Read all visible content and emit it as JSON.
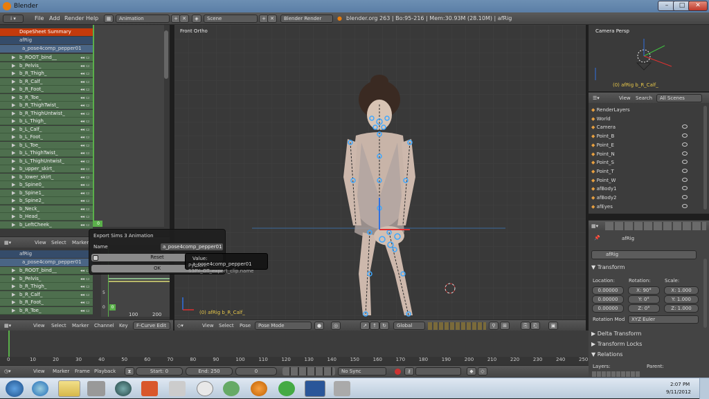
{
  "window": {
    "title": "Blender"
  },
  "menubar": {
    "menus": [
      "File",
      "Add",
      "Render",
      "Help"
    ],
    "screen_layout": "Animation",
    "scene": "Scene",
    "render_engine": "Blender Render",
    "stats": "blender.org 263 | Bo:95-216 | Mem:30.93M (28.10M) | afRig"
  },
  "dopesheet": {
    "summary": "DopeSheet Summary",
    "rig": "afRig",
    "action": "a_pose4comp_pepper01",
    "channels": [
      "b_ROOT_bind__",
      "b_Pelvis_",
      "b_R_Thigh_",
      "b_R_Calf_",
      "b_R_Foot_",
      "b_R_Toe_",
      "b_R_ThighTwist_",
      "b_R_ThighUntwist_",
      "b_L_Thigh_",
      "b_L_Calf_",
      "b_L_Foot_",
      "b_L_Toe_",
      "b_L_ThighTwist_",
      "b_L_ThighUntwist_",
      "b_upper_skirt_",
      "b_lower_skirt_",
      "b_Spine0_",
      "b_Spine1_",
      "b_Spine2_",
      "b_Neck_",
      "b_Head_",
      "b_LeftCheek_"
    ],
    "frame_marker": "0",
    "header": [
      "View",
      "Select",
      "Marker"
    ]
  },
  "export_dialog": {
    "title": "Export Sims 3 Animation",
    "name_label": "Name",
    "name_value": "a_pose4comp_pepper01",
    "reset_label": "Reset",
    "ok_label": "OK",
    "tooltip_value": "Value: a_pose4comp_pepper01",
    "tooltip_python": "Python: S3PY_OT_export_clip.name"
  },
  "graph_editor": {
    "rig": "afRig",
    "action": "a_pose4comp_pepper01",
    "channels": [
      "b_ROOT_bind__",
      "b_Pelvis_",
      "b_R_Thigh_",
      "b_R_Calf_",
      "b_R_Foot_",
      "b_R_Toe_"
    ],
    "ticks_y": [
      "5",
      "0"
    ],
    "ticks_x": [
      "100",
      "200"
    ],
    "frame_marker": "0",
    "header": [
      "View",
      "Select",
      "Marker",
      "Channel",
      "Key"
    ],
    "mode": "F-Curve Edit"
  },
  "viewport": {
    "label": "Front Ortho",
    "object_info": "(0) afRig b_R_Calf_",
    "header": [
      "View",
      "Select",
      "Pose"
    ],
    "mode": "Pose Mode",
    "orientation": "Global"
  },
  "camera_view": {
    "label": "Camera Persp",
    "object_info": "(0) afRig b_R_Calf_"
  },
  "outliner": {
    "header": [
      "View",
      "Search"
    ],
    "filter": "All Scenes",
    "items": [
      "RenderLayers",
      "World",
      "Camera",
      "Point_B",
      "Point_E",
      "Point_N",
      "Point_S",
      "Point_T",
      "Point_W",
      "afBody1",
      "afBody2",
      "afEyes"
    ]
  },
  "properties": {
    "breadcrumb": "afRig",
    "object_name": "afRig",
    "transform_title": "Transform",
    "location_label": "Location:",
    "rotation_label": "Rotation:",
    "scale_label": "Scale:",
    "location": [
      "0.00000",
      "0.00000",
      "0.00000"
    ],
    "rotation": [
      "X: 90°",
      "Y: 0°",
      "Z: 0°"
    ],
    "scale": [
      "X: 1.000",
      "Y: 1.000",
      "Z: 1.000"
    ],
    "rotation_mode_label": "Rotation Mod",
    "rotation_mode": "XYZ Euler",
    "delta_transform": "Delta Transform",
    "transform_locks": "Transform Locks",
    "relations": "Relations",
    "layers_label": "Layers:",
    "parent_label": "Parent:"
  },
  "timeline": {
    "ticks": [
      "0",
      "10",
      "20",
      "30",
      "40",
      "50",
      "60",
      "70",
      "80",
      "90",
      "100",
      "110",
      "120",
      "130",
      "140",
      "150",
      "160",
      "170",
      "180",
      "190",
      "200",
      "210",
      "220",
      "230",
      "240",
      "250"
    ],
    "header": [
      "View",
      "Marker",
      "Frame",
      "Playback"
    ],
    "start": "Start: 0",
    "end": "End: 250",
    "current": "0",
    "sync": "No Sync"
  },
  "taskbar": {
    "time": "2:07 PM",
    "date": "9/11/2012"
  }
}
